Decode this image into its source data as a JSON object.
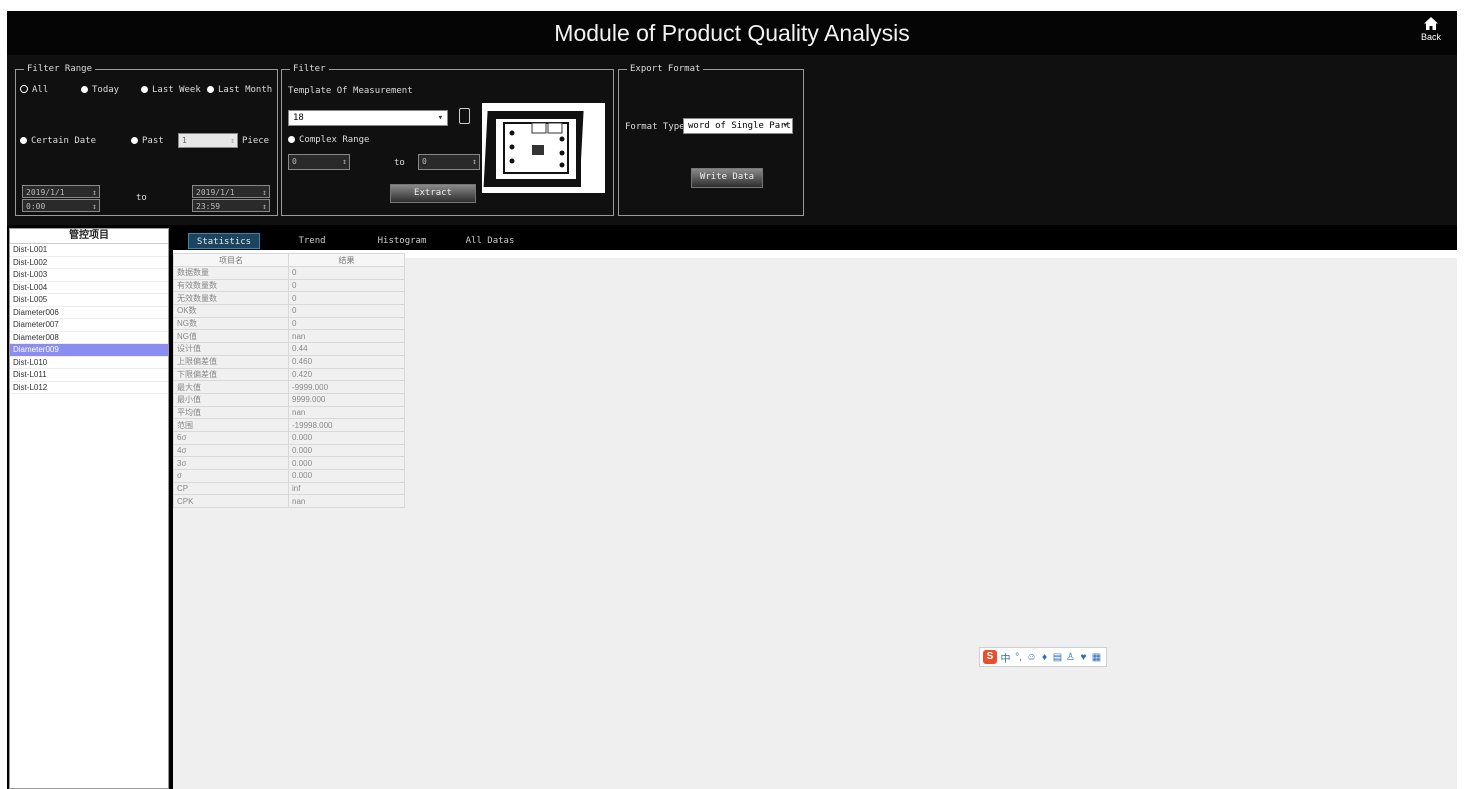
{
  "header": {
    "title": "Module of Product Quality Analysis",
    "back_label": "Back"
  },
  "filter_range": {
    "legend": "Filter Range",
    "radio_all": "All",
    "radio_today": "Today",
    "radio_last_week": "Last Week",
    "radio_last_month": "Last Month",
    "radio_certain_date": "Certain Date",
    "radio_past": "Past",
    "past_value": "1",
    "pieces_label": "Piece",
    "to_label": "to",
    "start_date": "2019/1/1",
    "start_time": "0:00",
    "end_date": "2019/1/1",
    "end_time": "23:59"
  },
  "filter": {
    "legend": "Filter",
    "template_label": "Template Of Measurement",
    "template_value": "18",
    "radio_complex": "Complex Range",
    "range_from": "0",
    "range_to": "0",
    "to_label": "to",
    "extract_label": "Extract"
  },
  "export": {
    "legend": "Export Format",
    "format_label": "Format Type",
    "format_value": "word of Single Part",
    "write_label": "Write Data"
  },
  "left_panel": {
    "header": "管控项目",
    "items": [
      "Dist-L001",
      "Dist-L002",
      "Dist-L003",
      "Dist-L004",
      "Dist-L005",
      "Diameter006",
      "Diameter007",
      "Diameter008",
      "Diameter009",
      "Dist-L010",
      "Dist-L011",
      "Dist-L012"
    ],
    "selected_index": 8
  },
  "tabs": [
    "Statistics",
    "Trend",
    "Histogram",
    "All Datas"
  ],
  "active_tab": 0,
  "stats_table": {
    "headers": [
      "项目名",
      "结果"
    ],
    "rows": [
      [
        "数据数量",
        "0"
      ],
      [
        "有效数量数",
        "0"
      ],
      [
        "无效数量数",
        "0"
      ],
      [
        "OK数",
        "0"
      ],
      [
        "NG数",
        "0"
      ],
      [
        "NG值",
        "nan"
      ],
      [
        "设计值",
        "0.44"
      ],
      [
        "上限偏差值",
        "0.460"
      ],
      [
        "下限偏差值",
        "0.420"
      ],
      [
        "最大值",
        "-9999.000"
      ],
      [
        "最小值",
        "9999.000"
      ],
      [
        "平均值",
        "nan"
      ],
      [
        "范围",
        "-19998.000"
      ],
      [
        "6σ",
        "0.000"
      ],
      [
        "4σ",
        "0.000"
      ],
      [
        "3σ",
        "0.000"
      ],
      [
        "σ",
        "0.000"
      ],
      [
        "CP",
        "inf"
      ],
      [
        "CPK",
        "nan"
      ]
    ]
  },
  "ime_toolbar": {
    "logo": "S",
    "icons": [
      "中",
      "°,",
      "☺",
      "♦",
      "▤",
      "♙",
      "♥",
      "▦"
    ]
  }
}
